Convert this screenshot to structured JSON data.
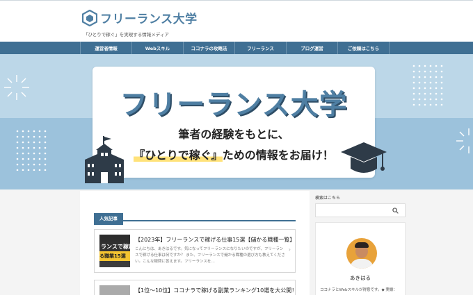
{
  "site": {
    "title": "フリーランス大学",
    "tagline": "「ひとりで稼ぐ」を実現する情報メディア"
  },
  "nav": {
    "items": [
      {
        "label": "運営者情報"
      },
      {
        "label": "Webスキル"
      },
      {
        "label": "ココナラの攻略法"
      },
      {
        "label": "フリーランス"
      },
      {
        "label": "ブログ運営"
      },
      {
        "label": "ご依頼はこちら"
      }
    ]
  },
  "hero": {
    "title": "フリーランス大学",
    "line1": "筆者の経験をもとに、",
    "line2_highlight": "『ひとりで稼ぐ』",
    "line2_rest": "ための情報をお届け！"
  },
  "main": {
    "section_label": "人気記事",
    "posts": [
      {
        "title": "【2023年】フリーランスで稼げる仕事15選【儲かる職種一覧】",
        "excerpt": "こんにちは、あきはるです。気になってフリーランスになりたいのですが、フリーランスで稼げる仕事は何ですか？ また、フリーランスで儲かる職種の選び方も教えてください。こんな疑問に答えます。フリーランスを…",
        "thumb_line1": "ランスで稼げる",
        "thumb_line2": "る職業15選"
      },
      {
        "title": "【1位〜10位】ココナラで稼げる副業ランキング10選を大公開！"
      }
    ]
  },
  "sidebar": {
    "search_label": "検索はこちら",
    "search_placeholder": "",
    "profile_name": "あきはる",
    "profile_desc": "ココナラとWebスキルが得意です。◆ 実績："
  },
  "colors": {
    "brand": "#4f7fa3",
    "nav_bg": "#3f6f93",
    "hero_light": "#bcd7e8",
    "hero_band": "#9cc2dc",
    "highlight": "#ffe27a"
  }
}
